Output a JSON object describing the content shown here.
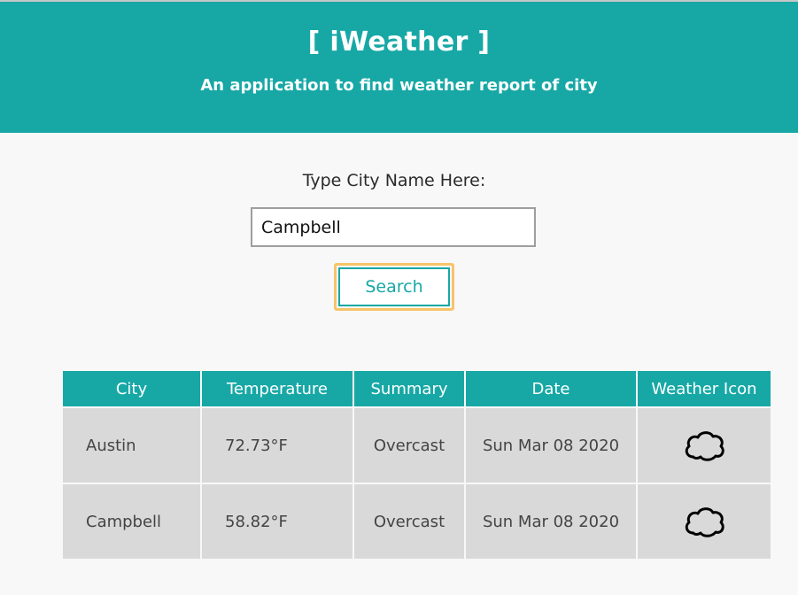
{
  "header": {
    "title": "[ iWeather ]",
    "subtitle": "An application to find weather report of city"
  },
  "search": {
    "prompt_label": "Type City Name Here:",
    "input_value": "Campbell",
    "button_label": "Search"
  },
  "table": {
    "headers": [
      "City",
      "Temperature",
      "Summary",
      "Date",
      "Weather Icon"
    ],
    "rows": [
      {
        "city": "Austin",
        "temperature": "72.73°F",
        "summary": "Overcast",
        "date": "Sun Mar 08 2020",
        "icon": "cloud-icon"
      },
      {
        "city": "Campbell",
        "temperature": "58.82°F",
        "summary": "Overcast",
        "date": "Sun Mar 08 2020",
        "icon": "cloud-icon"
      }
    ]
  },
  "colors": {
    "accent": "#17a8a6",
    "focus_ring": "#f7c46a",
    "row_bg": "#d9d9d9",
    "page_bg": "#f8f8f8"
  }
}
